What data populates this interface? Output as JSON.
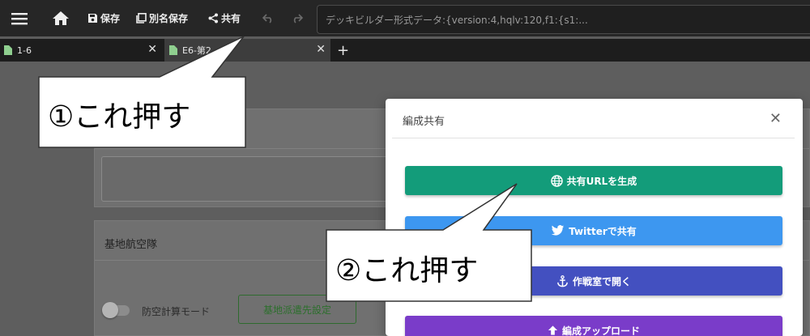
{
  "toolbar": {
    "menu_icon": "hamburger-icon",
    "home_icon": "home-icon",
    "save_label": "保存",
    "save_as_label": "別名保存",
    "share_label": "共有",
    "undo_icon": "undo-icon",
    "redo_icon": "redo-icon",
    "deck_data_value": "デッキビルダー形式データ:{version:4,hqlv:120,f1:{s1:..."
  },
  "tabs": [
    {
      "label": "1-6"
    },
    {
      "label": "E6-第2"
    }
  ],
  "background": {
    "air_base_title": "基地航空隊",
    "aa_mode_label": "防空計算モード",
    "base_dispatch_button": "基地派遣先設定"
  },
  "modal": {
    "title": "編成共有",
    "buttons": {
      "generate_url": "共有URLを生成",
      "twitter": "Twitterで共有",
      "strategy_room": "作戦室で開く",
      "upload": "編成アップロード"
    }
  },
  "callouts": {
    "first": "①これ押す",
    "second": "②これ押す"
  },
  "colors": {
    "url_button": "#139c7a",
    "twitter_button": "#3d97f0",
    "strategy_button": "#4350c0",
    "upload_button": "#7a3cc9"
  }
}
